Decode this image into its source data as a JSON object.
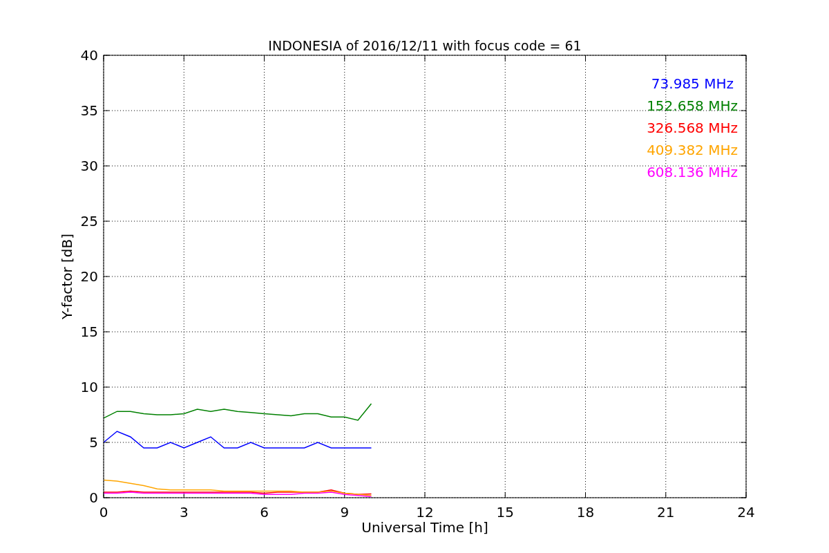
{
  "chart_data": {
    "type": "line",
    "title": "INDONESIA of 2016/12/11 with focus code = 61",
    "xlabel": "Universal Time [h]",
    "ylabel": "Y-factor [dB]",
    "x": [
      0,
      0.5,
      1,
      1.5,
      2,
      2.5,
      3,
      3.5,
      4,
      4.5,
      5,
      5.5,
      6,
      6.5,
      7,
      7.5,
      8,
      8.5,
      9,
      9.5,
      10
    ],
    "series": [
      {
        "name": "73.985 MHz",
        "color": "#0000ff",
        "values": [
          5,
          6,
          5.5,
          4.5,
          4.5,
          5,
          4.5,
          5,
          5.5,
          4.5,
          4.5,
          5,
          4.5,
          4.5,
          4.5,
          4.5,
          5,
          4.5,
          4.5,
          4.5,
          4.5
        ]
      },
      {
        "name": "152.658 MHz",
        "color": "#008000",
        "values": [
          7.2,
          7.8,
          7.8,
          7.6,
          7.5,
          7.5,
          7.6,
          8,
          7.8,
          8,
          7.8,
          7.7,
          7.6,
          7.5,
          7.4,
          7.6,
          7.6,
          7.3,
          7.3,
          7,
          8.5
        ]
      },
      {
        "name": "326.568 MHz",
        "color": "#ff0000",
        "values": [
          0.5,
          0.5,
          0.6,
          0.5,
          0.5,
          0.5,
          0.5,
          0.5,
          0.5,
          0.5,
          0.5,
          0.5,
          0.4,
          0.5,
          0.5,
          0.5,
          0.5,
          0.7,
          0.4,
          0.3,
          0.35
        ]
      },
      {
        "name": "409.382 MHz",
        "color": "#ffa500",
        "values": [
          1.6,
          1.5,
          1.3,
          1.1,
          0.8,
          0.7,
          0.7,
          0.7,
          0.7,
          0.6,
          0.6,
          0.6,
          0.6,
          0.6,
          0.6,
          0.5,
          0.5,
          0.6,
          0.4,
          0.3,
          0.2
        ]
      },
      {
        "name": "608.136 MHz",
        "color": "#ff00ff",
        "values": [
          0.4,
          0.4,
          0.5,
          0.4,
          0.4,
          0.4,
          0.4,
          0.4,
          0.4,
          0.4,
          0.4,
          0.4,
          0.3,
          0.3,
          0.3,
          0.4,
          0.4,
          0.5,
          0.3,
          0.2,
          0.1
        ]
      }
    ],
    "grid": true,
    "xlim": [
      0,
      24
    ],
    "ylim": [
      0,
      40
    ],
    "xticks": [
      0,
      3,
      6,
      9,
      12,
      15,
      18,
      21,
      24
    ],
    "yticks": [
      0,
      5,
      10,
      15,
      20,
      25,
      30,
      35,
      40
    ]
  }
}
